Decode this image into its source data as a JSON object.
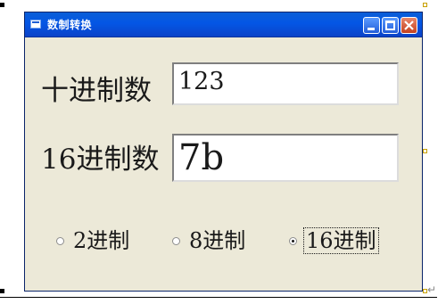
{
  "window": {
    "title": "数制转换",
    "title_icon": "app-window-icon",
    "controls": {
      "minimize": "minimize-icon",
      "maximize": "maximize-icon",
      "close": "close-icon"
    },
    "colors": {
      "titlebar": "#0456e5",
      "body": "#ece9d8",
      "close_button": "#c4421f"
    }
  },
  "form": {
    "decimal_label": "十进制数",
    "decimal_value": "123",
    "hex_label": "16进制数",
    "hex_value": "7b"
  },
  "radios": [
    {
      "label": "2进制",
      "checked": false
    },
    {
      "label": "8进制",
      "checked": false
    },
    {
      "label": "16进制",
      "checked": true
    }
  ]
}
